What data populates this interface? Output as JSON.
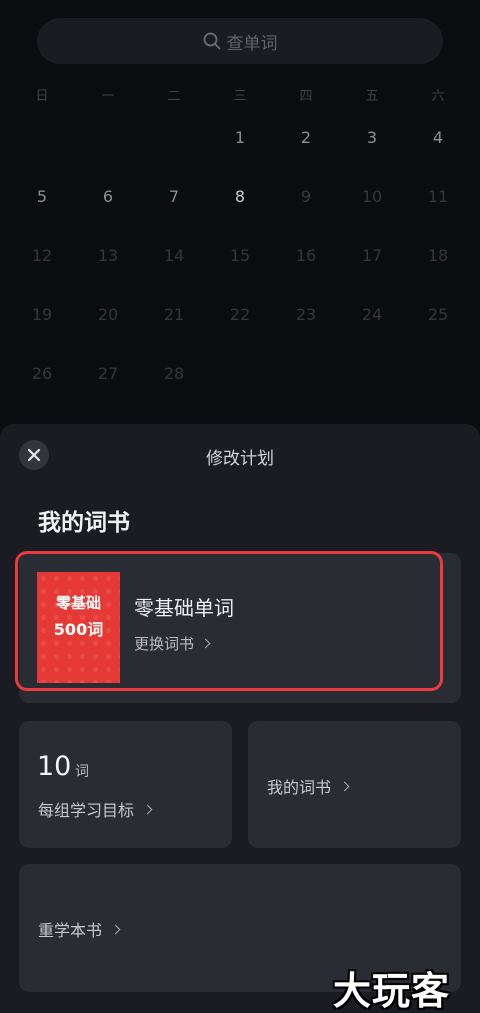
{
  "search": {
    "placeholder": "查单词"
  },
  "calendar": {
    "weekdays": [
      "日",
      "一",
      "二",
      "三",
      "四",
      "五",
      "六"
    ],
    "weeks": [
      [
        null,
        null,
        null,
        1,
        2,
        3,
        4
      ],
      [
        5,
        6,
        7,
        8,
        9,
        10,
        11
      ],
      [
        12,
        13,
        14,
        15,
        16,
        17,
        18
      ],
      [
        19,
        20,
        21,
        22,
        23,
        24,
        25
      ],
      [
        26,
        27,
        28,
        null,
        null,
        null,
        null
      ]
    ],
    "today": 8,
    "active_through": 8
  },
  "sheet": {
    "title": "修改计划",
    "section_title": "我的词书",
    "book": {
      "cover_line1": "零基础",
      "cover_line2": "500词",
      "name": "零基础单词",
      "change_label": "更换词书"
    },
    "goal": {
      "value": "10",
      "unit": "词",
      "label": "每组学习目标"
    },
    "my_books_label": "我的词书",
    "relearn_label": "重学本书"
  },
  "watermark": "大玩客",
  "colors": {
    "accent_red": "#e53935",
    "highlight": "#ea3c3f",
    "sheet_bg": "#1b1c21",
    "card_bg": "#2a2c33"
  }
}
